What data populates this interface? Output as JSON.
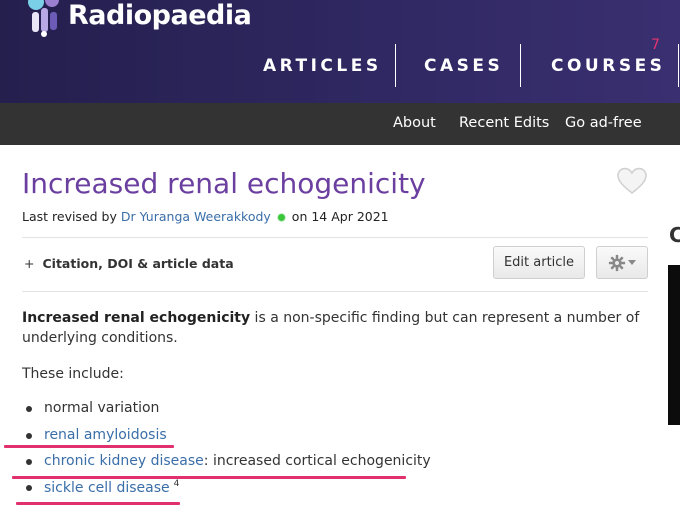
{
  "brand": {
    "name": "Radiopaedia"
  },
  "main_nav": {
    "items": [
      "ARTICLES",
      "CASES",
      "COURSES"
    ],
    "badge": "7"
  },
  "sub_nav": {
    "items": [
      "About",
      "Recent Edits",
      "Go ad-free"
    ]
  },
  "article": {
    "title": "Increased renal echogenicity",
    "revised_prefix": "Last revised by ",
    "author": "Dr Yuranga Weerakkody",
    "revised_suffix": " on 14 Apr 2021",
    "citation_plus": "+",
    "citation_label": "Citation, DOI & article data",
    "edit_button": "Edit article",
    "intro_bold": "Increased renal echogenicity",
    "intro_rest": " is a non-specific finding but can represent a number of underlying conditions.",
    "these_include": "These include:",
    "list": [
      {
        "text": "normal variation"
      },
      {
        "link": "renal amyloidosis"
      },
      {
        "link": "chronic kidney disease",
        "rest": ": increased cortical echogenicity"
      },
      {
        "link": "sickle cell disease",
        "sup": "4"
      }
    ],
    "right_heading_partial": "C"
  },
  "colors": {
    "header_bg": "#2f2862",
    "subnav_bg": "#333333",
    "title_purple": "#6b3fa0",
    "link_blue": "#3a6ea8",
    "annotation_pink": "#e0306e",
    "status_green": "#3cc63c"
  }
}
